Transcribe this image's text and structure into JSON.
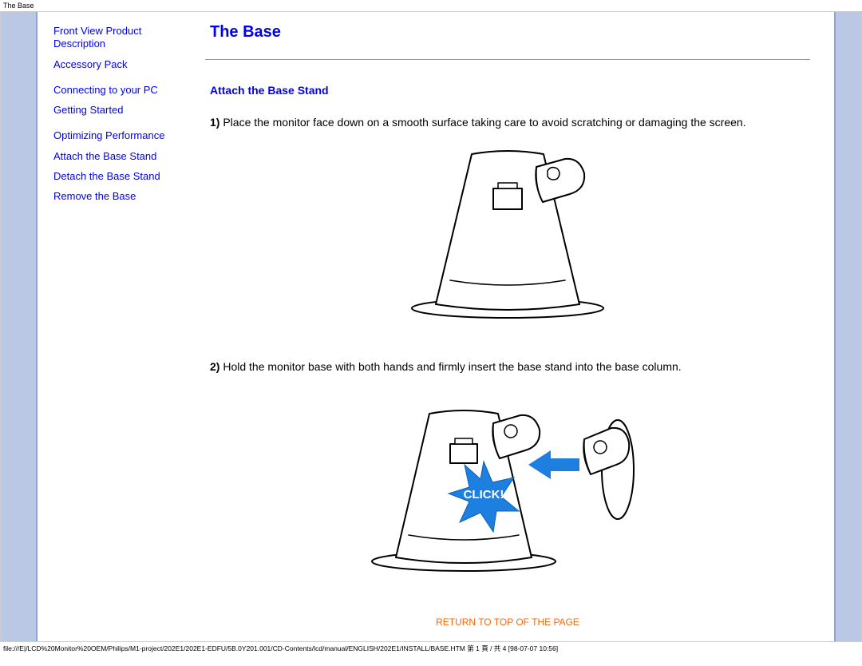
{
  "header": {
    "title": "The Base"
  },
  "sidebar": {
    "group1": {
      "front_view": "Front View Product Description",
      "accessory_pack": "Accessory Pack"
    },
    "group2": {
      "connecting": "Connecting to your PC",
      "getting_started": "Getting Started"
    },
    "group3": {
      "optimizing": "Optimizing Performance",
      "attach": "Attach the Base Stand",
      "detach": "Detach the Base Stand",
      "remove": "Remove the Base"
    }
  },
  "main": {
    "title": "The Base",
    "section_attach": "Attach the Base Stand",
    "step1_num": "1)",
    "step1_text": " Place the monitor face down on a smooth surface taking care to avoid scratching or damaging the screen.",
    "step2_num": "2)",
    "step2_text": " Hold the monitor base with both hands and firmly insert the base stand into the base column.",
    "click_label": "CLICK!",
    "return_link": "RETURN TO TOP OF THE PAGE"
  },
  "footer": {
    "path": "file:///E|/LCD%20Monitor%20OEM/Philips/M1-project/202E1/202E1-EDFU/5B.0Y201.001/CD-Contents/lcd/manual/ENGLISH/202E1/INSTALL/BASE.HTM 第 1 頁 / 共 4  [98-07-07 10:56]"
  }
}
